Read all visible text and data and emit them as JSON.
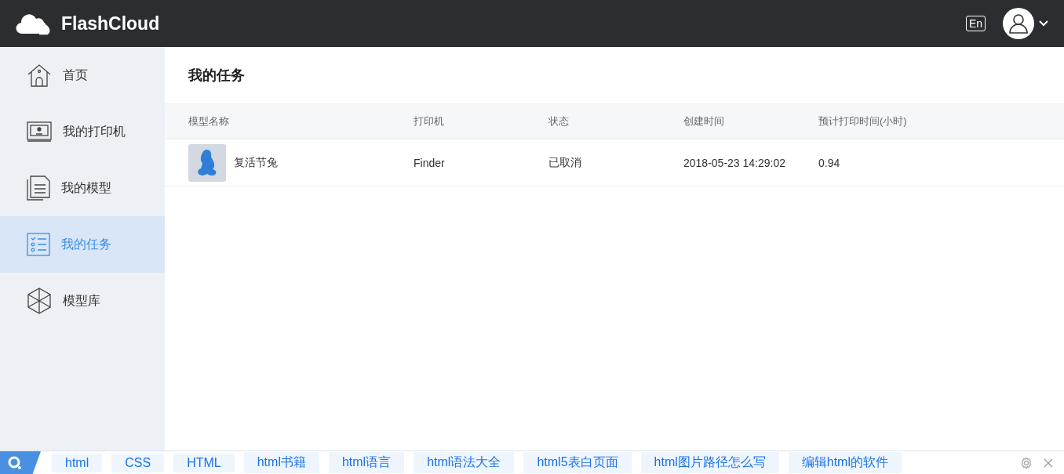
{
  "header": {
    "logo": "FlashCloud",
    "language_button": "En"
  },
  "sidebar": {
    "items": [
      {
        "label": "首页",
        "selected": false
      },
      {
        "label": "我的打印机",
        "selected": false
      },
      {
        "label": "我的模型",
        "selected": false
      },
      {
        "label": "我的任务",
        "selected": true
      },
      {
        "label": "模型库",
        "selected": false
      }
    ]
  },
  "page_title": "我的任务",
  "table": {
    "columns": [
      "模型名称",
      "打印机",
      "状态",
      "创建时间",
      "预计打印时间(小时)"
    ],
    "rows": [
      {
        "model": "复活节兔",
        "printer": "Finder",
        "status": "已取消",
        "created": "2018-05-23 14:29:02",
        "estimated_hours": "0.94"
      }
    ]
  },
  "suggestion_bar": {
    "tags": [
      "html",
      "CSS",
      "HTML",
      "html书籍",
      "html语言",
      "html语法大全",
      "html5表白页面",
      "html图片路径怎么写",
      "编辑html的软件"
    ]
  }
}
